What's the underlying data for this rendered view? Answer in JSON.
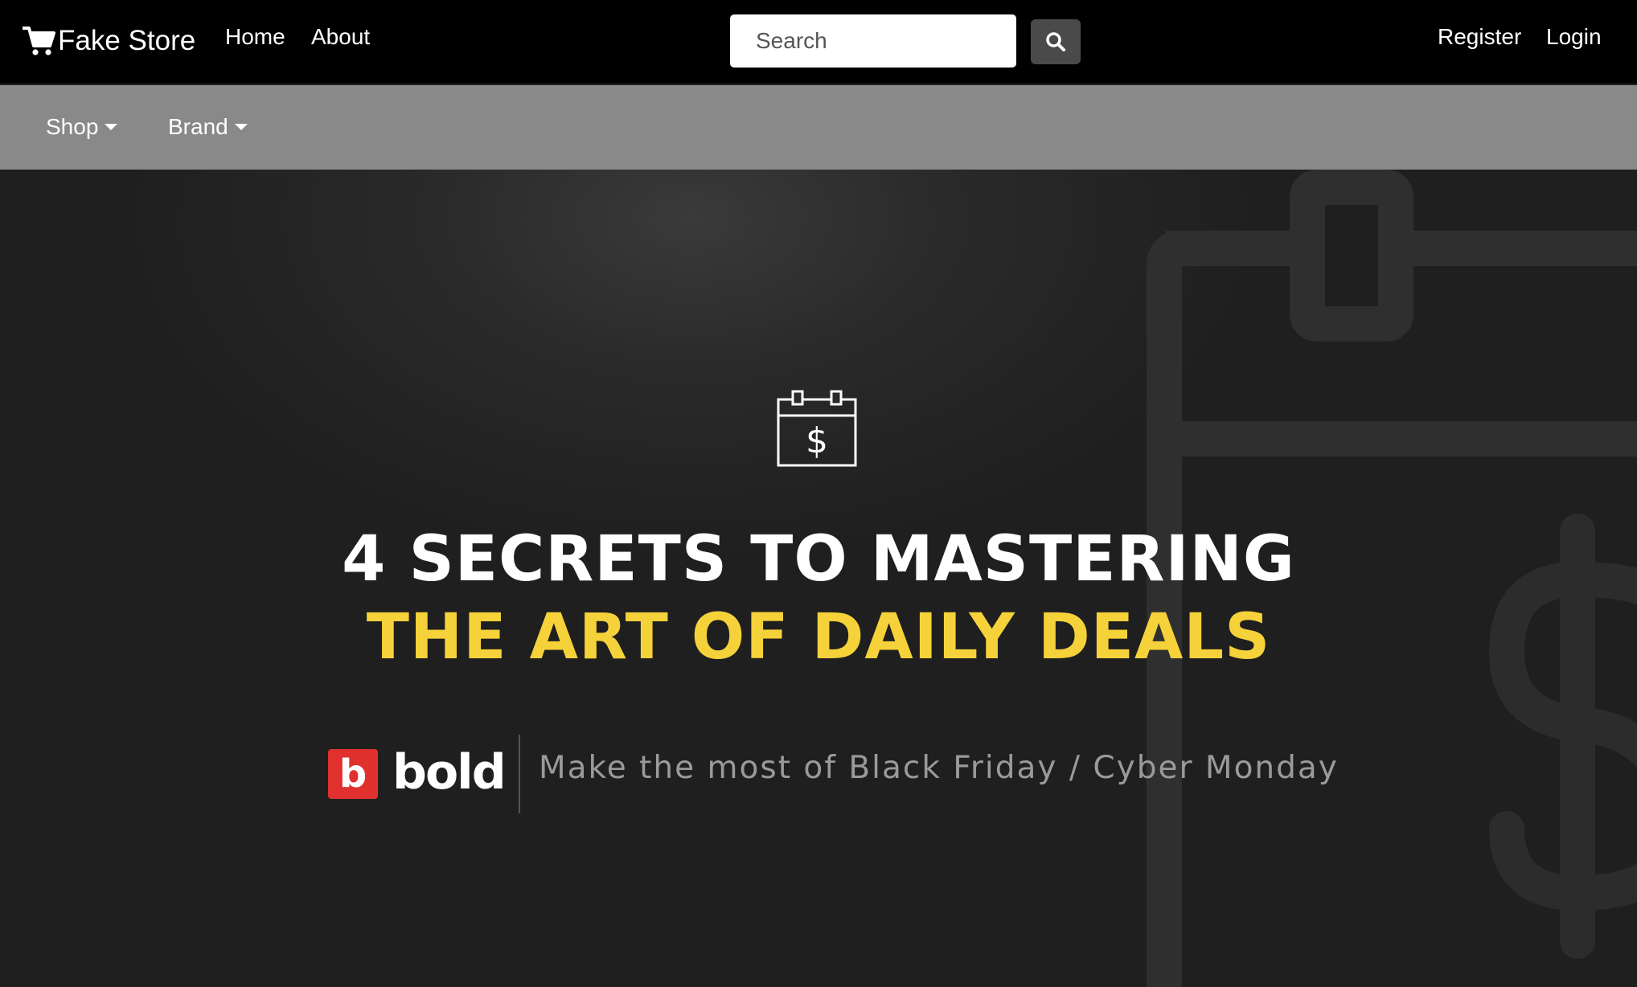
{
  "navbar": {
    "brand": "Fake Store",
    "links": {
      "home": "Home",
      "about": "About",
      "register": "Register",
      "login": "Login"
    },
    "search": {
      "placeholder": "Search"
    }
  },
  "subnav": {
    "shop": "Shop",
    "brand": "Brand"
  },
  "hero": {
    "headline_line1": "4 SECRETS TO MASTERING",
    "headline_line2": "THE ART OF DAILY DEALS",
    "logo_mark": "b",
    "logo_text": "bold",
    "tagline": "Make the most of Black Friday / Cyber Monday",
    "icon": "calendar-dollar-icon"
  },
  "colors": {
    "navbar_bg": "#000000",
    "subnav_bg": "#898989",
    "hero_bg": "#1f1f1f",
    "highlight_yellow": "#f6d23a",
    "logo_red": "#e0312e",
    "search_button_bg": "#4a4a4a"
  }
}
